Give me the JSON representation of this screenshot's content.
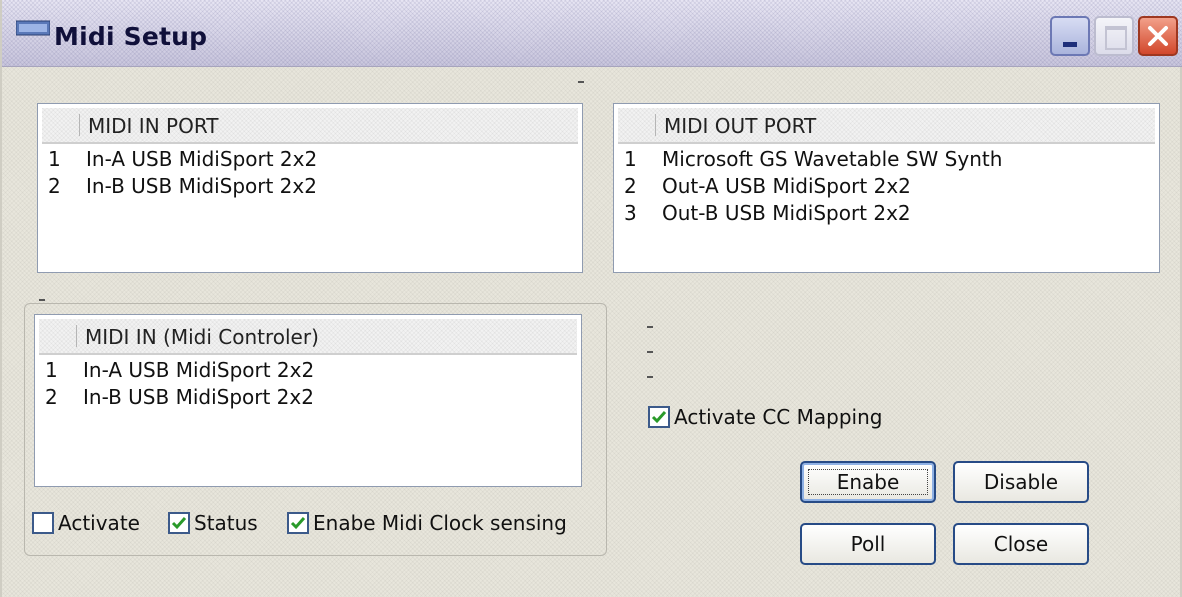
{
  "window": {
    "title": "Midi Setup"
  },
  "midi_in_port": {
    "header": "MIDI IN PORT",
    "rows": [
      {
        "index": "1",
        "name": "In-A USB MidiSport 2x2"
      },
      {
        "index": "2",
        "name": "In-B USB MidiSport 2x2"
      }
    ]
  },
  "midi_out_port": {
    "header": "MIDI OUT PORT",
    "rows": [
      {
        "index": "1",
        "name": "Microsoft GS Wavetable SW Synth"
      },
      {
        "index": "2",
        "name": "Out-A USB MidiSport 2x2"
      },
      {
        "index": "3",
        "name": "Out-B USB MidiSport 2x2"
      }
    ]
  },
  "midi_in_controller": {
    "header": "MIDI IN (Midi Controler)",
    "rows": [
      {
        "index": "1",
        "name": "In-A USB MidiSport 2x2"
      },
      {
        "index": "2",
        "name": "In-B USB MidiSport 2x2"
      }
    ]
  },
  "checkboxes": {
    "activate": {
      "label": "Activate",
      "checked": false
    },
    "status": {
      "label": "Status",
      "checked": true
    },
    "midi_clock": {
      "label": "Enabe Midi Clock sensing",
      "checked": true
    },
    "cc_mapping": {
      "label": "Activate CC Mapping",
      "checked": true
    }
  },
  "buttons": {
    "enable": "Enabe",
    "disable": "Disable",
    "poll": "Poll",
    "close": "Close"
  },
  "colors": {
    "check": "#2a9a2a",
    "button_border": "#274b86",
    "close_red": "#d2472b"
  }
}
